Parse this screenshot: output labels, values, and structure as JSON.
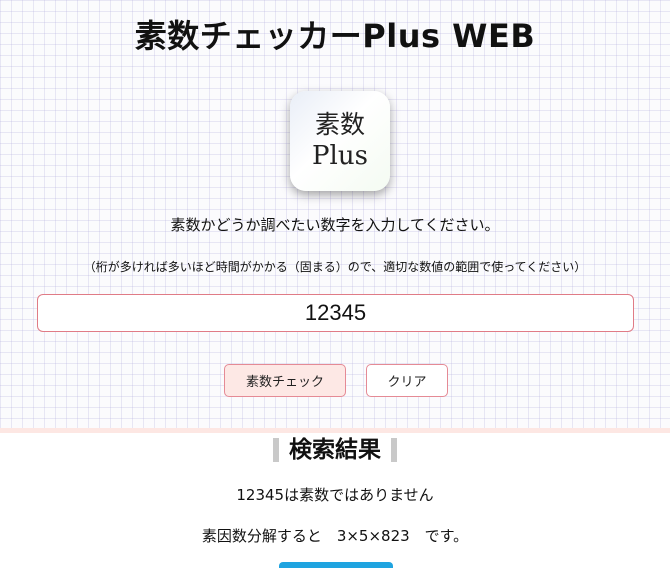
{
  "app": {
    "title": "素数チェッカーPlus WEB"
  },
  "logo": {
    "line1": "素数",
    "line2": "Plus"
  },
  "form": {
    "instruction": "素数かどうか調べたい数字を入力してください。",
    "note": "（桁が多ければ多いほど時間がかかる（固まる）ので、適切な数値の範囲で使ってください）",
    "input_value": "12345"
  },
  "buttons": {
    "check_label": "素数チェック",
    "clear_label": "クリア"
  },
  "result": {
    "heading": "検索結果",
    "message": "12345は素数ではありません",
    "factorization": "素因数分解すると　3×5×823　です。"
  },
  "colors": {
    "accent_border": "#e07b86",
    "button_fill": "#fde8e5",
    "divider": "#fde7e3",
    "heading_bar": "#c9c9c9",
    "action_blue": "#1fa4e0"
  }
}
